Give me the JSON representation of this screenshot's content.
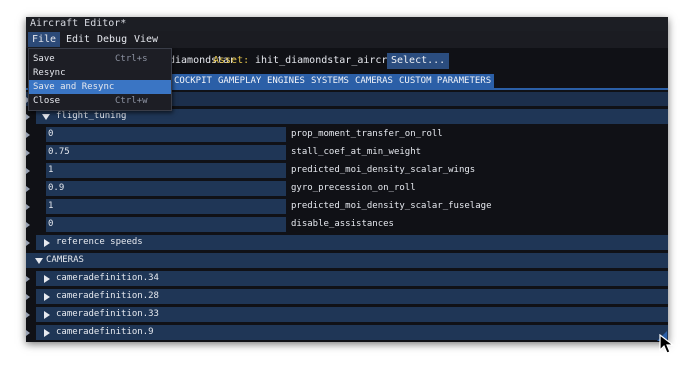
{
  "window": {
    "title": "Aircraft Editor*"
  },
  "menubar": {
    "items": [
      "File",
      "Edit",
      "Debug",
      "View"
    ]
  },
  "file_menu": {
    "items": [
      {
        "label": "Save",
        "shortcut": "Ctrl+s"
      },
      {
        "label": "Resync",
        "shortcut": ""
      },
      {
        "label": "Save and Resync",
        "shortcut": ""
      },
      {
        "label": "Close",
        "shortcut": "Ctrl+w"
      }
    ],
    "highlighted": "Save and Resync"
  },
  "assetbar": {
    "package_value": "diamondstar",
    "asset_label": "Asset:",
    "asset_value": "ihit_diamondstar_aircraft",
    "select_button": "Select..."
  },
  "tabs": [
    "COCKPIT",
    "GAMEPLAY",
    "ENGINES",
    "SYSTEMS",
    "CAMERAS",
    "CUSTOM PARAMETERS"
  ],
  "flight_tuning": {
    "label": "flight_tuning",
    "params": [
      {
        "value": "0",
        "name": "prop_moment_transfer_on_roll"
      },
      {
        "value": "0.75",
        "name": "stall_coef_at_min_weight"
      },
      {
        "value": "1",
        "name": "predicted_moi_density_scalar_wings"
      },
      {
        "value": "0.9",
        "name": "gyro_precession_on_roll"
      },
      {
        "value": "1",
        "name": "predicted_moi_density_scalar_fuselage"
      },
      {
        "value": "0",
        "name": "disable_assistances"
      }
    ]
  },
  "reference_speeds": {
    "label": "reference speeds"
  },
  "cameras": {
    "label": "CAMERAS",
    "items": [
      "cameradefinition.34",
      "cameradefinition.28",
      "cameradefinition.33",
      "cameradefinition.9"
    ]
  },
  "colors": {
    "accent": "#2b5fa7",
    "row": "#1f3656",
    "highlight": "#3a75c4",
    "asset_label": "#e2c24a"
  }
}
